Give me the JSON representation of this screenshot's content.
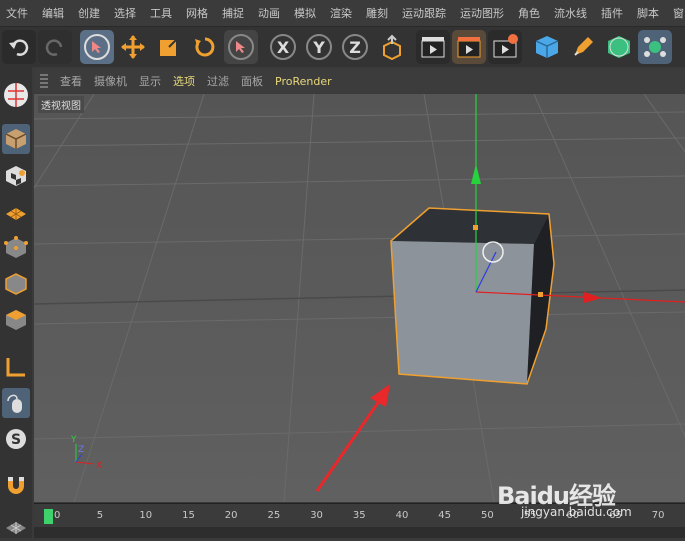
{
  "menubar": {
    "items": [
      "文件",
      "编辑",
      "创建",
      "选择",
      "工具",
      "网格",
      "捕捉",
      "动画",
      "模拟",
      "渲染",
      "雕刻",
      "运动跟踪",
      "运动图形",
      "角色",
      "流水线",
      "插件",
      "脚本",
      "窗口"
    ]
  },
  "viewport": {
    "menu": [
      "查看",
      "摄像机",
      "显示",
      "选项",
      "过滤",
      "面板",
      "ProRender"
    ],
    "highlighted": [
      "选项",
      "ProRender"
    ],
    "label": "透视视图"
  },
  "axes": {
    "x": "X",
    "y": "Y",
    "z": "Z"
  },
  "timeline": {
    "ticks": [
      "0",
      "5",
      "10",
      "15",
      "20",
      "25",
      "30",
      "35",
      "40",
      "45",
      "50",
      "55",
      "60",
      "65",
      "70"
    ]
  },
  "watermark": {
    "brand": "Baidu经验",
    "url": "jingyan.baidu.com"
  },
  "colors": {
    "accent_orange": "#f0a030",
    "selection_blue": "#5b6f86",
    "frame_green": "#3fd16b"
  }
}
